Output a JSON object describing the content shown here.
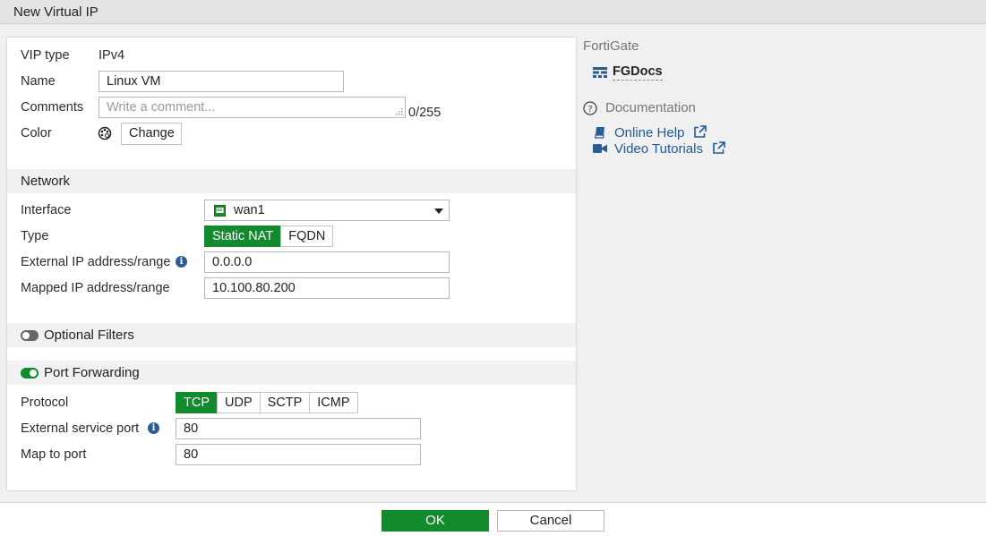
{
  "window": {
    "title": "New Virtual IP"
  },
  "form": {
    "vip_type_label": "VIP type",
    "vip_type_value": "IPv4",
    "name_label": "Name",
    "name_value": "Linux VM",
    "comments_label": "Comments",
    "comments_placeholder": "Write a comment...",
    "comments_counter": "0/255",
    "color_label": "Color",
    "color_change_button": "Change",
    "network_section": {
      "title": "Network",
      "interface_label": "Interface",
      "interface_value": "wan1",
      "type_label": "Type",
      "type_options": [
        "Static NAT",
        "FQDN"
      ],
      "type_selected": "Static NAT",
      "external_ip_label": "External IP address/range",
      "external_ip_value": "0.0.0.0",
      "mapped_ip_label": "Mapped IP address/range",
      "mapped_ip_value": "10.100.80.200"
    },
    "optional_filters": {
      "title": "Optional Filters",
      "enabled": false
    },
    "port_forwarding": {
      "title": "Port Forwarding",
      "enabled": true,
      "protocol_label": "Protocol",
      "protocol_options": [
        "TCP",
        "UDP",
        "SCTP",
        "ICMP"
      ],
      "protocol_selected": "TCP",
      "external_port_label": "External service port",
      "external_port_value": "80",
      "map_to_port_label": "Map to port",
      "map_to_port_value": "80"
    }
  },
  "sidebar": {
    "device_header": "FortiGate",
    "device_name": "FGDocs",
    "documentation_header": "Documentation",
    "links": [
      "Online Help",
      "Video Tutorials"
    ]
  },
  "footer": {
    "ok_label": "OK",
    "cancel_label": "Cancel"
  },
  "colors": {
    "accent_green": "#138a2e",
    "link_blue": "#1e5a9a",
    "icon_blue": "#2a5d95"
  }
}
